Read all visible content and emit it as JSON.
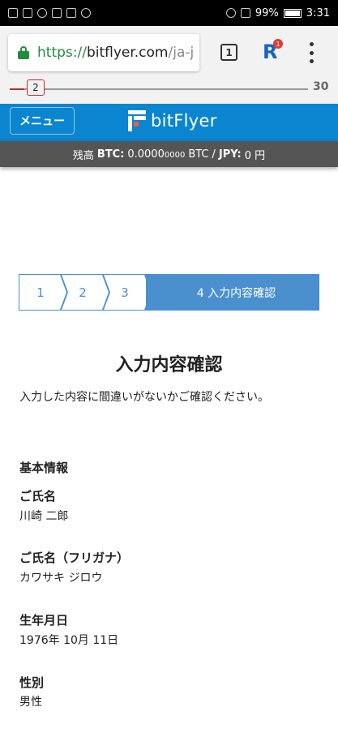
{
  "status_bar": {
    "battery": "99%",
    "time": "3:31"
  },
  "browser": {
    "url_scheme": "https://",
    "url_host": "bitflyer.com",
    "url_path": "/ja-j",
    "tab_count": "1",
    "extension_badge": "1"
  },
  "slider": {
    "value": "2",
    "max_label": "30",
    "fill_fraction": 0.05
  },
  "header": {
    "menu_label": "メニュー",
    "logo_text": "bitFlyer"
  },
  "balance": {
    "label": "残高",
    "btc_label": "BTC:",
    "btc_value_main": "0.0000",
    "btc_value_small": "0000",
    "btc_unit": "BTC",
    "separator": "/",
    "jpy_label": "JPY:",
    "jpy_value": "0 円"
  },
  "steps": [
    {
      "label": "1"
    },
    {
      "label": "2"
    },
    {
      "label": "3"
    },
    {
      "label": "4 入力内容確認"
    }
  ],
  "page": {
    "title": "入力内容確認",
    "instruction": "入力した内容に間違いがないかご確認ください。",
    "section_title": "基本情報",
    "fields": [
      {
        "label": "ご氏名",
        "value": "川崎 二郎"
      },
      {
        "label": "ご氏名（フリガナ）",
        "value": "カワサキ ジロウ"
      },
      {
        "label": "生年月日",
        "value": "1976年 10月 11日"
      },
      {
        "label": "性別",
        "value": "男性"
      }
    ]
  },
  "colors": {
    "brand_blue": "#0b85cf",
    "step_blue": "#4a90cf",
    "balance_bar": "#555555",
    "secure_green": "#1e8e3e",
    "slider_red": "#c62828"
  }
}
